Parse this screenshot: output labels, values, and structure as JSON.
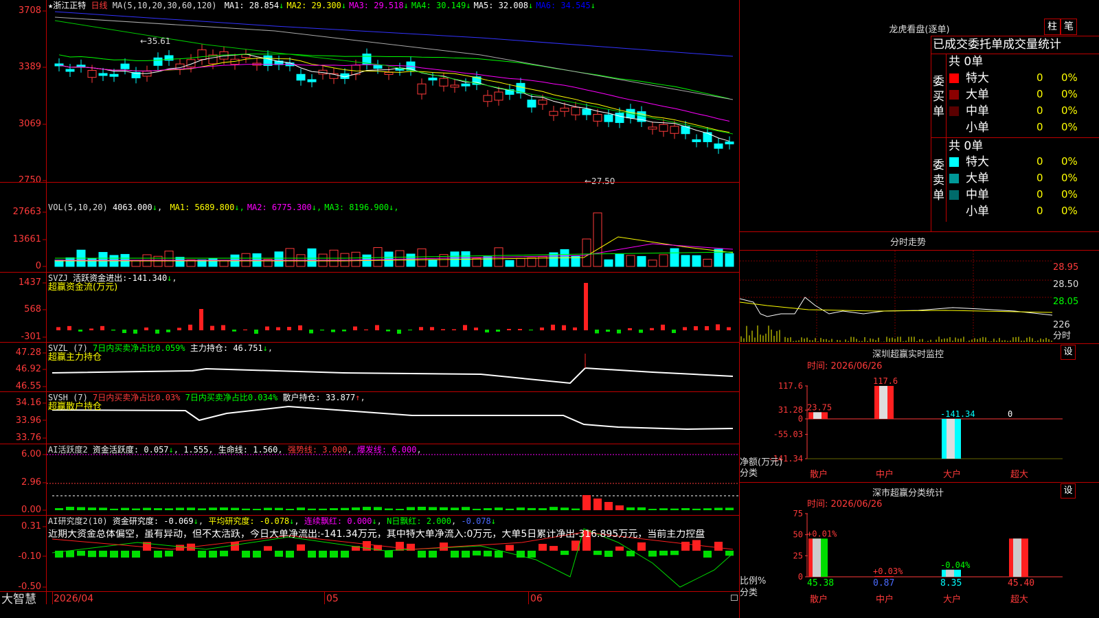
{
  "main": {
    "stock_name": "浙江正特",
    "period": "日线",
    "ma_header": "MA(5,10,20,30,60,120)",
    "ma_values": [
      {
        "label": "MA1:",
        "value": "28.854",
        "color": "#ffffff"
      },
      {
        "label": "MA2:",
        "value": "29.300",
        "color": "#ffff00"
      },
      {
        "label": "MA3:",
        "value": "29.518",
        "color": "#ff00ff"
      },
      {
        "label": "MA4:",
        "value": "30.149",
        "color": "#00ff00"
      },
      {
        "label": "MA5:",
        "value": "32.008",
        "color": "#ffffff"
      },
      {
        "label": "MA6:",
        "value": "34.545",
        "color": "#0000ff"
      }
    ],
    "y_ticks": [
      "3708",
      "3389",
      "3069",
      "2750"
    ],
    "high_label": "←35.61",
    "low_label": "←27.50"
  },
  "vol": {
    "header": "VOL(5,10,20)",
    "current": "4063.000",
    "ma": [
      {
        "label": "MA1:",
        "value": "5689.800",
        "color": "#ffff00"
      },
      {
        "label": "MA2:",
        "value": "6775.300",
        "color": "#ff00ff"
      },
      {
        "label": "MA3:",
        "value": "8196.900",
        "color": "#00ff00"
      }
    ],
    "y_ticks": [
      "27663",
      "13661",
      "0"
    ]
  },
  "svzj": {
    "header": "SVZJ",
    "label": "活跃资金进出:",
    "value": "-141.340",
    "subtitle": "超赢资金流(万元)",
    "y_ticks": [
      "1437",
      "568",
      "-301"
    ]
  },
  "svzl": {
    "header": "SVZL (7)",
    "text1": "7日内买卖净占比0.059%",
    "label": "主力持仓:",
    "value": "46.751",
    "subtitle": "超赢主力持仓",
    "y_ticks": [
      "47.28",
      "46.92",
      "46.55"
    ]
  },
  "svsh": {
    "header": "SVSH (7)",
    "text1": "7日内买卖净占比0.03%",
    "text2": "7日内买卖净占比0.034%",
    "label": "散户持仓:",
    "value": "33.877",
    "subtitle": "超赢散户持仓",
    "y_ticks": [
      "34.16",
      "33.96",
      "33.76"
    ]
  },
  "ai_active": {
    "header": "AI活跃度2",
    "label1": "资金活跃度:",
    "value1": "0.057",
    "value2": "1.555",
    "label3": "生命线:",
    "value3": "1.560",
    "label4": "强势线:",
    "value4": "3.000",
    "label5": "爆发线:",
    "value5": "6.000",
    "y_ticks": [
      "6.00",
      "2.96",
      "0.00"
    ]
  },
  "ai_research": {
    "header": "AI研究度2(10)",
    "label1": "资金研究度:",
    "value1": "-0.069",
    "label2": "平均研究度:",
    "value2": "-0.078",
    "label3": "连续飘红:",
    "value3": "0.000",
    "label4": "N日飘红:",
    "value4": "2.000",
    "value5": "-0.078",
    "comment": "近期大资金总体偏空，虽有异动，但不太活跃，今日大单净流出:-141.34万元，其中特大单净流入:0万元，大单5日累计净出-316.895万元，当前主力控盘",
    "y_ticks": [
      "0.31",
      "-0.10",
      "-0.50"
    ]
  },
  "bottom": {
    "logo": "大智慧",
    "date_start": "2026/04",
    "month_05": "05",
    "month_06": "06"
  },
  "dragon": {
    "title": "龙虎看盘(逐单)",
    "btn_zhu": "柱",
    "btn_bi": "笔",
    "subtitle": "已成交委托单成交量统计",
    "buy_side": "委买单",
    "sell_side": "委卖单",
    "buy_total": "共 0单",
    "sell_total": "共 0单",
    "buy_rows": [
      {
        "label": "特大",
        "count": "0",
        "pct": "0%",
        "color": "#ff0000"
      },
      {
        "label": "大单",
        "count": "0",
        "pct": "0%",
        "color": "#8b0000"
      },
      {
        "label": "中单",
        "count": "0",
        "pct": "0%",
        "color": "#5a0000"
      },
      {
        "label": "小单",
        "count": "0",
        "pct": "0%",
        "color": ""
      }
    ],
    "sell_rows": [
      {
        "label": "特大",
        "count": "0",
        "pct": "0%",
        "color": "#00ffff"
      },
      {
        "label": "大单",
        "count": "0",
        "pct": "0%",
        "color": "#009999"
      },
      {
        "label": "中单",
        "count": "0",
        "pct": "0%",
        "color": "#006b6b"
      },
      {
        "label": "小单",
        "count": "0",
        "pct": "0%",
        "color": ""
      }
    ]
  },
  "intraday": {
    "title": "分时走势",
    "y_ticks": [
      "28.95",
      "28.50",
      "28.05"
    ],
    "vol_tick": "226",
    "vol_label": "分时"
  },
  "sz_monitor": {
    "title": "深圳超赢实时监控",
    "btn": "设",
    "time": "时间: 2026/06/26",
    "y_ticks": [
      "117.6",
      "31.28",
      "0",
      "-55.03",
      "-141.34"
    ],
    "y_label": "净额(万元)",
    "x_label": "分类",
    "categories": [
      "散户",
      "中户",
      "大户",
      "超大"
    ],
    "values": [
      "23.75",
      "117.6",
      "-141.34",
      "0"
    ]
  },
  "sz_class": {
    "title": "深市超赢分类统计",
    "btn": "设",
    "time": "时间: 2026/06/26",
    "y_ticks": [
      "75",
      "50",
      "25",
      "0"
    ],
    "y_label": "比例%",
    "x_label": "分类",
    "categories": [
      "散户",
      "中户",
      "大户",
      "超大"
    ],
    "changes": [
      "+0.01%",
      "+0.03%",
      "-0.04%",
      ""
    ],
    "values": [
      "45.38",
      "0.87",
      "8.35",
      "45.40"
    ]
  },
  "chart_data": [
    {
      "type": "bar",
      "title": "深圳超赢实时监控",
      "categories": [
        "散户",
        "中户",
        "大户",
        "超大"
      ],
      "values": [
        23.75,
        117.6,
        -141.34,
        0
      ],
      "ylabel": "净额(万元)",
      "xlabel": "分类",
      "ylim": [
        -141.34,
        117.6
      ]
    },
    {
      "type": "bar",
      "title": "深市超赢分类统计",
      "categories": [
        "散户",
        "中户",
        "大户",
        "超大"
      ],
      "values": [
        45.38,
        0.87,
        8.35,
        45.4
      ],
      "ylabel": "比例%",
      "xlabel": "分类",
      "ylim": [
        0,
        75
      ]
    }
  ]
}
